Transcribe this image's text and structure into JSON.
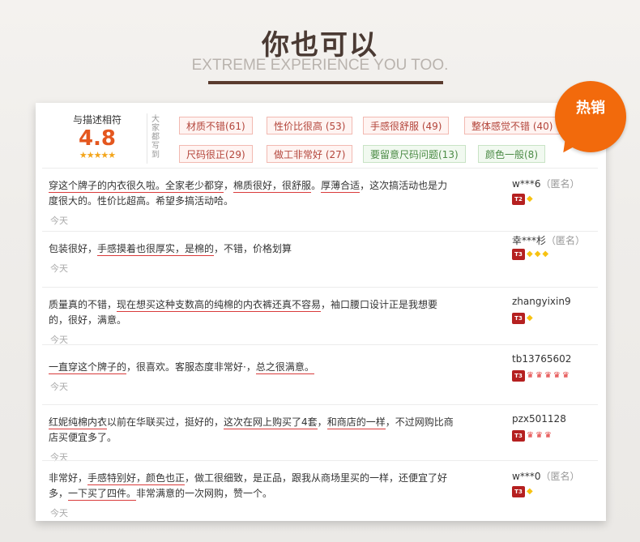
{
  "header": {
    "title": "你也可以",
    "subtitle": "EXTREME EXPERIENCE YOU TOO."
  },
  "hot_badge": "热销",
  "rating": {
    "label": "与描述相符",
    "score": "4.8",
    "stars": "★★★★★"
  },
  "tags_heading": "大家都写到",
  "tags": [
    {
      "label": "材质不错(61)",
      "tone": "positive"
    },
    {
      "label": "性价比很高 (53)",
      "tone": "positive"
    },
    {
      "label": "手感很舒服 (49)",
      "tone": "positive"
    },
    {
      "label": "整体感觉不错 (40)",
      "tone": "positive"
    },
    {
      "label": "尺码很正(29)",
      "tone": "positive"
    },
    {
      "label": "做工非常好 (27)",
      "tone": "positive"
    },
    {
      "label": "要留意尺码问题(13)",
      "tone": "neutral"
    },
    {
      "label": "颜色一般(8)",
      "tone": "neutral"
    }
  ],
  "reviews": [
    {
      "segments": [
        {
          "t": "穿这个牌子的内衣很久啦。",
          "hl": true
        },
        {
          "t": "全家老少都穿",
          "hl": true
        },
        {
          "t": "，",
          "hl": false
        },
        {
          "t": "棉质很好，很舒服",
          "hl": true
        },
        {
          "t": "。",
          "hl": false
        },
        {
          "t": "厚薄合适",
          "hl": true
        },
        {
          "t": "，这次搞活动也是力度很大的。性价比超高。希望多搞活动哈。",
          "hl": false
        }
      ],
      "date": "今天",
      "user": "w***6",
      "anon": "（匿名）",
      "level": "T2",
      "icons": [
        "diamond"
      ]
    },
    {
      "segments": [
        {
          "t": "包装很好，",
          "hl": false
        },
        {
          "t": "手感摸着也很厚实，是棉的",
          "hl": true
        },
        {
          "t": "，不错，价格划算",
          "hl": false
        }
      ],
      "date": "今天",
      "user": "幸***杉",
      "anon": "（匿名）",
      "level": "T3",
      "icons": [
        "diamond",
        "diamond",
        "diamond"
      ]
    },
    {
      "segments": [
        {
          "t": "质量真的不错，",
          "hl": false
        },
        {
          "t": "现在想买这种支数高的纯棉的内衣裤还真不容易",
          "hl": true
        },
        {
          "t": "，袖口腰口设计正是我想要的，很好，满意。",
          "hl": false
        }
      ],
      "date": "今天",
      "user": "zhangyixin9",
      "anon": "",
      "level": "T3",
      "icons": [
        "diamond"
      ]
    },
    {
      "segments": [
        {
          "t": "一直穿这个牌子的",
          "hl": true
        },
        {
          "t": "，很喜欢。客服态度非常好·，",
          "hl": false
        },
        {
          "t": "总之很满意。",
          "hl": true
        }
      ],
      "date": "今天",
      "user": "tb13765602",
      "anon": "",
      "level": "T3",
      "icons": [
        "crown",
        "crown",
        "crown",
        "crown",
        "crown"
      ]
    },
    {
      "segments": [
        {
          "t": "红妮纯棉内衣",
          "hl": true
        },
        {
          "t": "以前在华联买过，挺好的，",
          "hl": false
        },
        {
          "t": "这次在网上购买了4套",
          "hl": true
        },
        {
          "t": "，",
          "hl": false
        },
        {
          "t": "和商店的一样",
          "hl": true
        },
        {
          "t": "，不过网购比商店买便宜多了。",
          "hl": false
        }
      ],
      "date": "今天",
      "user": "pzx501128",
      "anon": "",
      "level": "T3",
      "icons": [
        "crown",
        "crown",
        "crown"
      ]
    },
    {
      "segments": [
        {
          "t": "非常好，",
          "hl": false
        },
        {
          "t": "手感特别好，颜色也正",
          "hl": true
        },
        {
          "t": "，做工很细致，是正品，跟我从商场里买的一样，还便宜了好多，",
          "hl": false
        },
        {
          "t": "一下买了四件。",
          "hl": true
        },
        {
          "t": "非常满意的一次网购，赞一个。",
          "hl": false
        }
      ],
      "date": "今天",
      "user": "w***0",
      "anon": "（匿名）",
      "level": "T3",
      "icons": [
        "diamond"
      ]
    }
  ]
}
